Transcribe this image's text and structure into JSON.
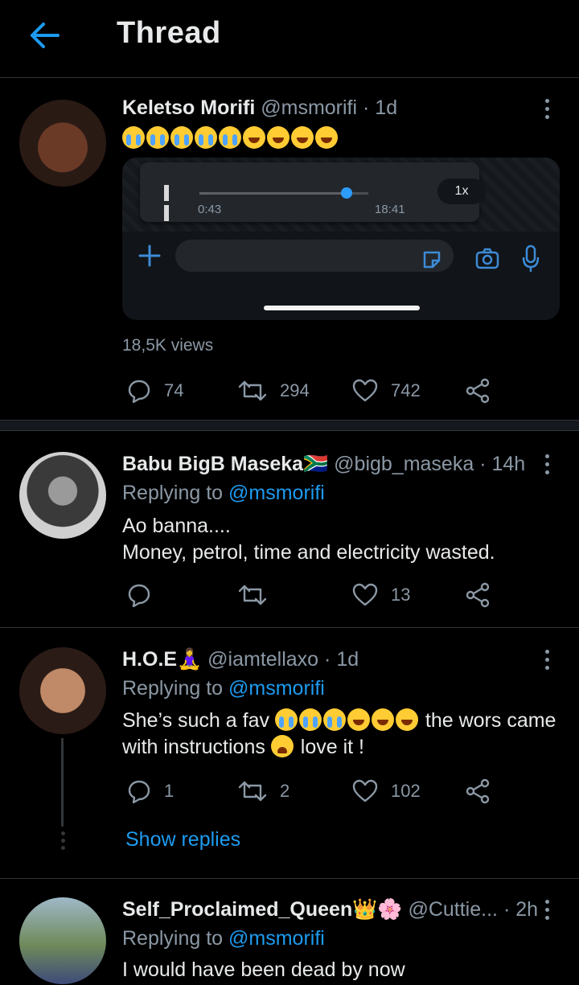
{
  "header": {
    "title": "Thread"
  },
  "main_tweet": {
    "name": "Keletso Morifi",
    "handle": "@msmorifi",
    "time": "· 1d",
    "emojis": [
      "cry",
      "cry",
      "cry",
      "cry",
      "cry",
      "laugh",
      "laugh",
      "laugh",
      "laugh"
    ],
    "media": {
      "elapsed": "0:43",
      "duration": "18:41",
      "speed": "1x",
      "progress": 0.87
    },
    "views": "18,5K views",
    "replies": "74",
    "retweets": "294",
    "likes": "742"
  },
  "replies": [
    {
      "name": "Babu BigB Maseka🇿🇦",
      "handle": "@bigb_maseka",
      "time": "· 14h",
      "replying_prefix": "Replying to",
      "replying_to": "@msmorifi",
      "line1": "Ao banna....",
      "line2": "Money, petrol, time and electricity wasted.",
      "replies": "",
      "retweets": "",
      "likes": "13"
    },
    {
      "name": "H.O.E🧘‍♀️",
      "handle": "@iamtellaxo",
      "time": "· 1d",
      "replying_prefix": "Replying to",
      "replying_to": "@msmorifi",
      "text_a": "She’s such a fav",
      "text_b": "the wors came",
      "text_c": "with instructions",
      "text_d": "love it !",
      "replies": "1",
      "retweets": "2",
      "likes": "102",
      "show_replies": "Show replies"
    },
    {
      "name": "Self_Proclaimed_Queen👑🌸",
      "handle": "@Cuttie...",
      "time": "· 2h",
      "replying_prefix": "Replying to",
      "replying_to": "@msmorifi",
      "line1": "I would have been dead by now"
    }
  ],
  "colors": {
    "accent": "#1d9bf0",
    "muted": "#8b98a5",
    "text": "#e7e9ea",
    "bg": "#000000"
  }
}
